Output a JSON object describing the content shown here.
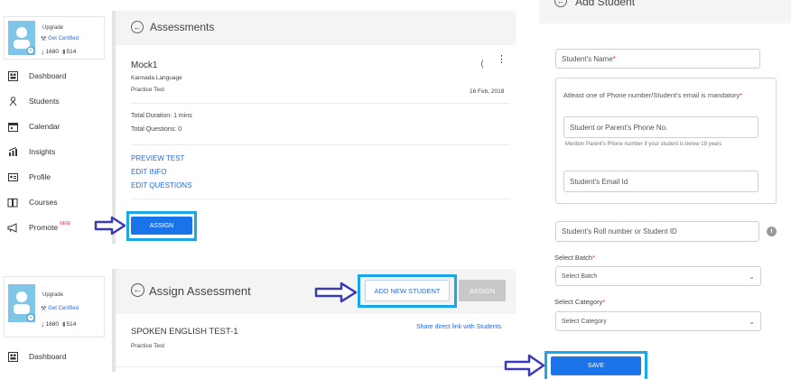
{
  "panel1": {
    "profile": {
      "upgrade": "Upgrade",
      "certified": "Get Certified",
      "down_count": "1680",
      "bar_count": "514"
    },
    "nav": [
      {
        "label": "Dashboard",
        "icon": "dashboard-icon"
      },
      {
        "label": "Students",
        "icon": "students-icon"
      },
      {
        "label": "Calendar",
        "icon": "calendar-icon"
      },
      {
        "label": "Insights",
        "icon": "insights-icon"
      },
      {
        "label": "Profile",
        "icon": "profile-icon"
      },
      {
        "label": "Courses",
        "icon": "courses-icon"
      },
      {
        "label": "Promote",
        "icon": "promote-icon",
        "badge": "NEW"
      }
    ],
    "header_title": "Assessments",
    "test": {
      "name": "Mock1",
      "language": "Kannada Language",
      "type": "Practice Test",
      "date": "16 Feb, 2018",
      "duration": "Total Duration: 1 mins",
      "questions": "Total Questions: 0"
    },
    "links": [
      "PREVIEW TEST",
      "EDIT INFO",
      "EDIT QUESTIONS"
    ],
    "assign_label": "ASSIGN"
  },
  "panel2": {
    "profile": {
      "upgrade": "Upgrade",
      "certified": "Get Certified",
      "down_count": "1680",
      "bar_count": "514"
    },
    "nav": [
      {
        "label": "Dashboard",
        "icon": "dashboard-icon"
      }
    ],
    "header_title": "Assign Assessment",
    "add_student_label": "ADD NEW STUDENT",
    "assign_label": "ASSIGN",
    "test_name": "SPOKEN ENGLISH TEST-1",
    "test_type": "Practice Test",
    "share_link": "Share direct link with Students"
  },
  "panel3": {
    "title": "Add Student",
    "student_name": "Student's Name",
    "mandatory_note": "Atleast one of Phone number/Student's email is mandatory",
    "phone_placeholder": "Student or Parent's Phone No.",
    "phone_hint": "Mention Parent's Phone number if your student is below 18 years",
    "email_placeholder": "Student's Email Id",
    "roll_placeholder": "Student's Roll number or Student ID",
    "batch_label": "Select Batch",
    "batch_value": "Select Batch",
    "category_label": "Select Category",
    "category_value": "Select Category",
    "save_label": "SAVE",
    "required_mark": "*"
  },
  "colors": {
    "accent": "#1a73e8",
    "highlight": "#1aa7e8",
    "arrow": "#3a3ab8",
    "required": "#e0243a"
  }
}
